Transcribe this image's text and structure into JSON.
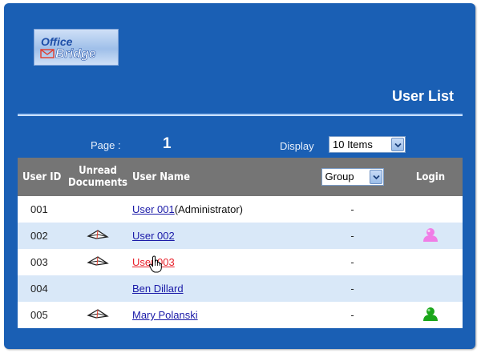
{
  "logo": {
    "line1": "Office",
    "line2": "Bridge"
  },
  "header": {
    "title": "User List"
  },
  "toolbar": {
    "page_label": "Page :",
    "page_number": "1",
    "display_label": "Display",
    "display_value": "10 Items"
  },
  "table": {
    "headers": {
      "user_id": "User ID",
      "unread_line1": "Unread",
      "unread_line2": "Documents",
      "user_name": "User Name",
      "group_value": "Group",
      "login": "Login"
    },
    "rows": [
      {
        "id": "001",
        "name": "User 001",
        "suffix": "(Administrator)",
        "group": "-",
        "unread": false,
        "login": "none"
      },
      {
        "id": "002",
        "name": "User 002",
        "suffix": "",
        "group": "-",
        "unread": true,
        "login": "pink"
      },
      {
        "id": "003",
        "name": "User 003",
        "suffix": "",
        "group": "-",
        "unread": true,
        "login": "none"
      },
      {
        "id": "004",
        "name": "Ben Dillard",
        "suffix": "",
        "group": "-",
        "unread": false,
        "login": "none"
      },
      {
        "id": "005",
        "name": "Mary Polanski",
        "suffix": "",
        "group": "-",
        "unread": true,
        "login": "green"
      }
    ]
  },
  "colors": {
    "panel": "#1a5fb4",
    "header_row": "#757575",
    "row_alt": "#d9e8f8",
    "link": "#1a1aa8",
    "link_hover": "#e8212b",
    "login_pink": "#f07de6",
    "login_green": "#1aa61a"
  },
  "icons": {
    "unread": "envelope-icon",
    "login": "user-icon",
    "dropdown": "chevron-down-icon",
    "cursor": "hand-cursor-icon"
  }
}
